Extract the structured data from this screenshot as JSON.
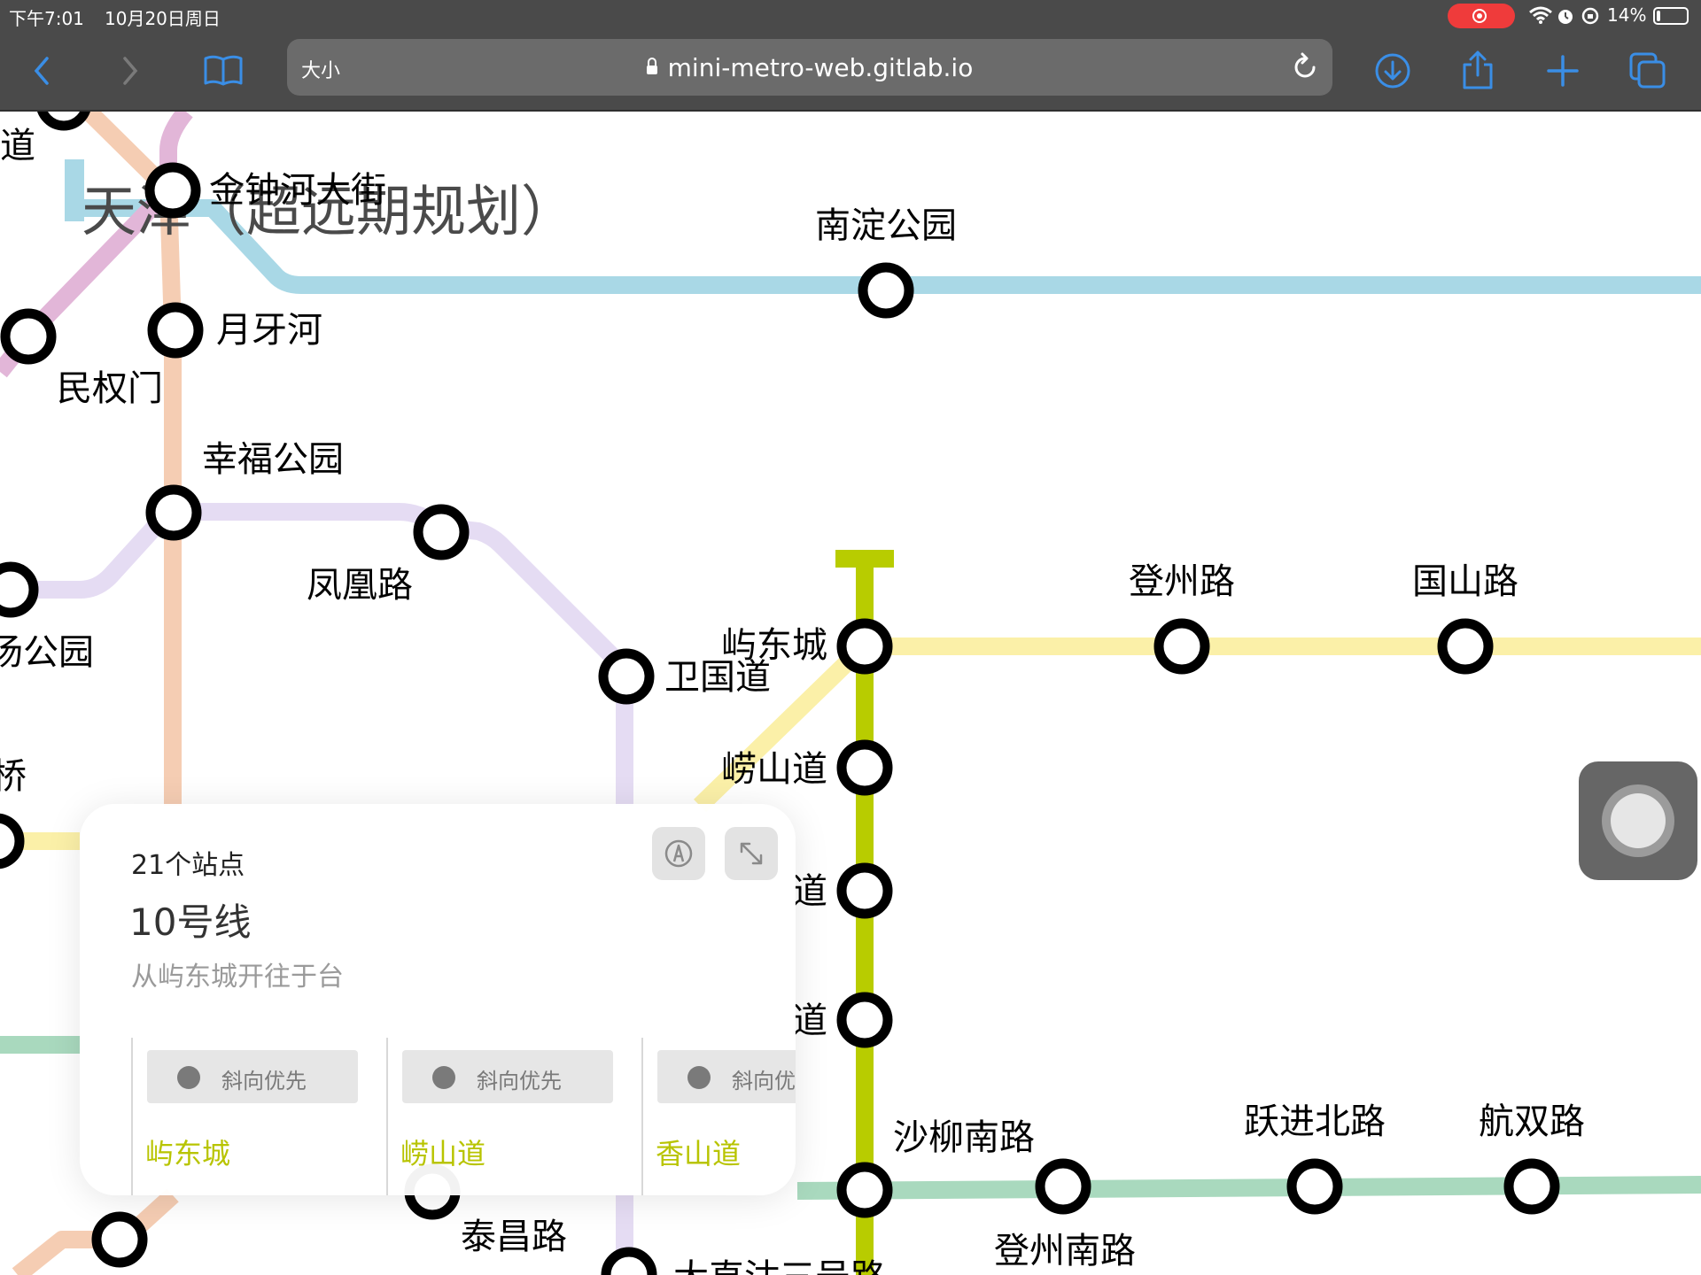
{
  "status_bar": {
    "time": "下午7:01",
    "date": "10月20日周日",
    "battery": "14%",
    "battery_fraction": 0.14,
    "recording_color": "#ef3b3b"
  },
  "browser": {
    "text_size_label": "大小",
    "url": "mini-metro-web.gitlab.io",
    "accent_color": "#3a8ee6",
    "icons": [
      "back-icon",
      "forward-icon",
      "bookmarks-icon",
      "lock-icon",
      "reload-icon",
      "download-icon",
      "share-icon",
      "new-tab-icon",
      "tabs-icon"
    ]
  },
  "map": {
    "title": "天津（超远期规划）",
    "stations": [
      {
        "id": "dao_top",
        "label": "道"
      },
      {
        "id": "jinzhonghe",
        "label": "金钟河大街"
      },
      {
        "id": "nandian",
        "label": "南淀公园"
      },
      {
        "id": "yueyahe",
        "label": "月牙河"
      },
      {
        "id": "minquanmen",
        "label": "民权门"
      },
      {
        "id": "xingfu",
        "label": "幸福公园"
      },
      {
        "id": "fenghuang",
        "label": "凤凰路"
      },
      {
        "id": "yang",
        "label": "汤公园"
      },
      {
        "id": "weiguo",
        "label": "卫国道"
      },
      {
        "id": "yudongcheng",
        "label": "屿东城"
      },
      {
        "id": "dengzhou",
        "label": "登州路"
      },
      {
        "id": "guoshan",
        "label": "国山路"
      },
      {
        "id": "laoshan",
        "label": "崂山道"
      },
      {
        "id": "qiao",
        "label": "桥"
      },
      {
        "id": "dao_a",
        "label": "道"
      },
      {
        "id": "dao_b",
        "label": "道"
      },
      {
        "id": "shaliunan",
        "label": "沙柳南路"
      },
      {
        "id": "yuejinbei",
        "label": "跃进北路"
      },
      {
        "id": "hangshuang",
        "label": "航双路"
      },
      {
        "id": "dengzhounan",
        "label": "登州南路"
      },
      {
        "id": "taichang",
        "label": "泰昌路"
      },
      {
        "id": "bottom_cut",
        "label": "大直沽三号路"
      }
    ],
    "line_colors": {
      "cyan": "#a9d8e6",
      "pink": "#e2b6d8",
      "peach": "#f5cdb3",
      "lavender": "#e5dcf3",
      "yellow": "#fbf0a8",
      "lime": "#b8cc00",
      "mint": "#a9d9be"
    }
  },
  "line_card": {
    "station_count": "21个站点",
    "line_name": "10号线",
    "direction": "从屿东城开往于台",
    "line_color": "#b8c400",
    "stops": [
      {
        "priority": "斜向优先",
        "name": "屿东城"
      },
      {
        "priority": "斜向优先",
        "name": "崂山道"
      },
      {
        "priority": "斜向优先",
        "name": "香山道"
      }
    ],
    "icons": [
      "pen-icon",
      "expand-icon"
    ]
  }
}
